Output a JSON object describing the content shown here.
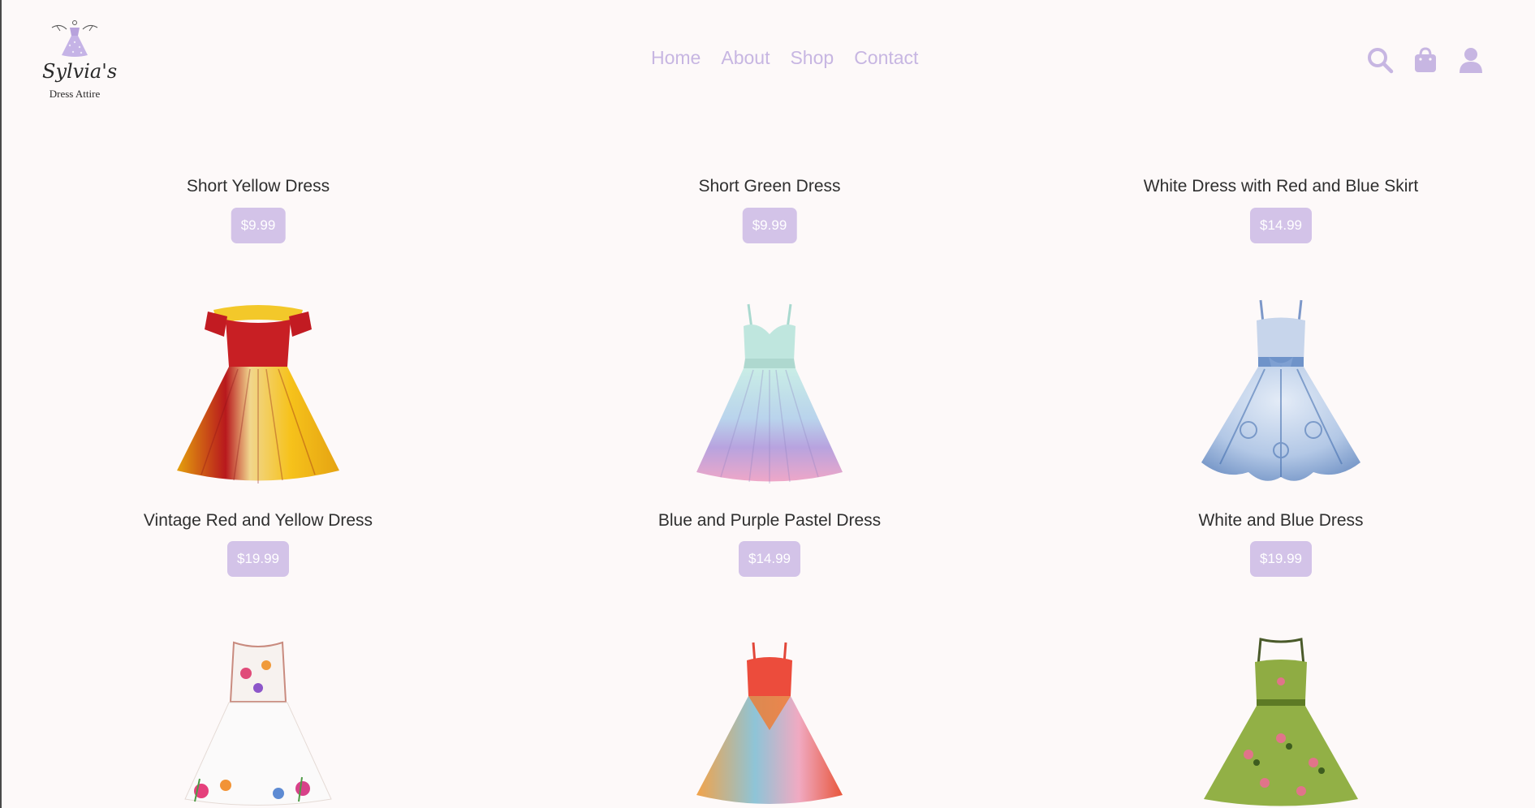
{
  "brand": {
    "name": "Sylvia's",
    "tagline": "Dress Attire"
  },
  "nav": {
    "items": [
      {
        "label": "Home"
      },
      {
        "label": "About"
      },
      {
        "label": "Shop"
      },
      {
        "label": "Contact"
      }
    ]
  },
  "header_icons": [
    "search-icon",
    "shopping-bag-icon",
    "user-icon"
  ],
  "colors": {
    "accent": "#c7b6e2",
    "price_button": "#d3c3e8",
    "background": "#fdf9f9",
    "text": "#2f2f2f"
  },
  "products": [
    {
      "name": "Short Yellow Dress",
      "price": "$9.99"
    },
    {
      "name": "Short Green Dress",
      "price": "$9.99"
    },
    {
      "name": "White Dress with Red and Blue Skirt",
      "price": "$14.99"
    },
    {
      "name": "Vintage Red and Yellow Dress",
      "price": "$19.99"
    },
    {
      "name": "Blue and Purple Pastel Dress",
      "price": "$14.99"
    },
    {
      "name": "White and Blue Dress",
      "price": "$19.99"
    },
    {
      "name": "",
      "price": ""
    },
    {
      "name": "",
      "price": ""
    },
    {
      "name": "",
      "price": ""
    }
  ]
}
